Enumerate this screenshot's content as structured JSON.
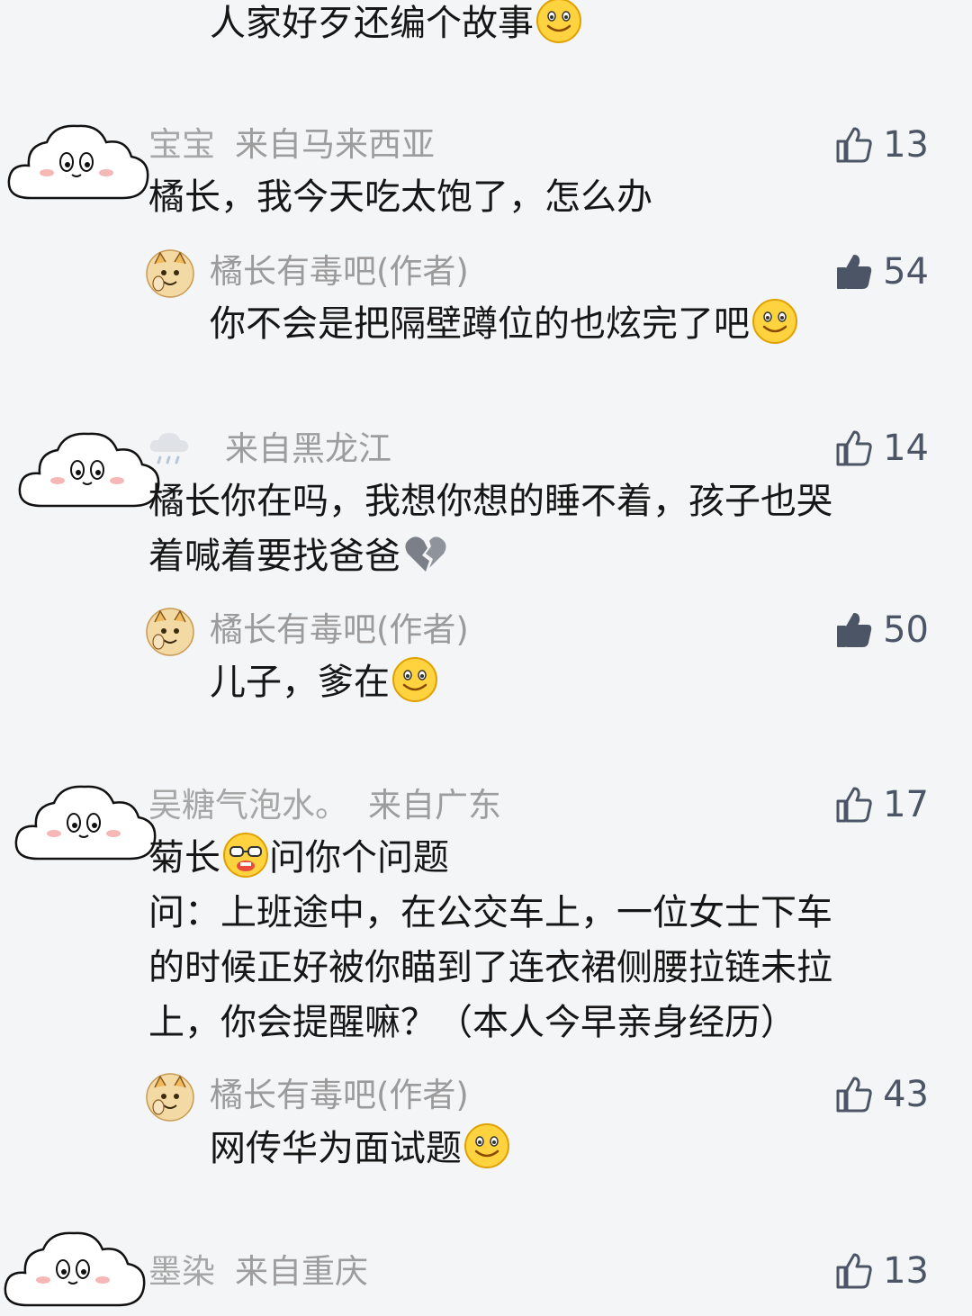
{
  "top": {
    "text": "人家好歹还编个故事",
    "emoji": "smile-emoji"
  },
  "comments": [
    {
      "username": "宝宝",
      "location": "来自马来西亚",
      "likes": "13",
      "liked": false,
      "text_lines": [
        "橘长，我今天吃太饱了，怎么办"
      ],
      "reply": {
        "author": "橘长有毒吧(作者)",
        "likes": "54",
        "liked": true,
        "text": "你不会是把隔壁蹲位的也炫完了吧",
        "emoji": "smile-emoji"
      }
    },
    {
      "username": "",
      "location": "来自黑龙江",
      "likes": "14",
      "liked": false,
      "text_lines": [
        "橘长你在吗，我想你想的睡不着，孩子也哭",
        "着喊着要找爸爸"
      ],
      "reply": {
        "author": "橘长有毒吧(作者)",
        "likes": "50",
        "liked": true,
        "text": "儿子，爹在",
        "emoji": "smile-emoji"
      }
    },
    {
      "username": "吴糖气泡水。",
      "location": "来自广东",
      "likes": "17",
      "liked": false,
      "text_lines": [
        "菊长",
        "问你个问题",
        "问：上班途中，在公交车上，一位女士下车",
        "的时候正好被你瞄到了连衣裙侧腰拉链未拉",
        "上，你会提醒嘛？（本人今早亲身经历）"
      ],
      "reply": {
        "author": "橘长有毒吧(作者)",
        "likes": "43",
        "liked": false,
        "text": "网传华为面试题",
        "emoji": "smile-emoji"
      }
    },
    {
      "username": "墨染",
      "location": "来自重庆",
      "likes": "13",
      "liked": false
    }
  ],
  "colors": {
    "background": "#f4f5f7",
    "text": "#161616",
    "meta": "#9d9d9d",
    "like_icon": "#4c5566"
  }
}
